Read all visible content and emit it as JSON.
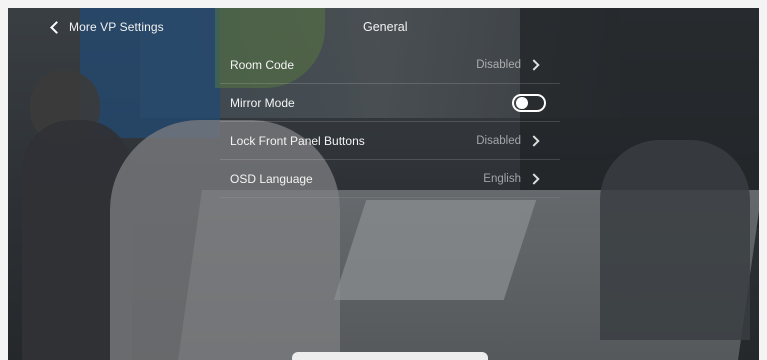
{
  "header": {
    "back_label": "More VP Settings",
    "title": "General"
  },
  "settings": {
    "rows": [
      {
        "label": "Room Code",
        "value": "Disabled",
        "type": "nav"
      },
      {
        "label": "Mirror Mode",
        "value": "",
        "type": "toggle",
        "state": "off"
      },
      {
        "label": "Lock Front Panel Buttons",
        "value": "Disabled",
        "type": "nav"
      },
      {
        "label": "OSD Language",
        "value": "English",
        "type": "nav"
      }
    ]
  },
  "icons": {
    "back": "chevron-left-icon",
    "nav": "chevron-right-icon"
  },
  "colors": {
    "text_primary": "#f4f4f4",
    "text_secondary": "#9a9a9a",
    "toggle": "#ffffff"
  }
}
